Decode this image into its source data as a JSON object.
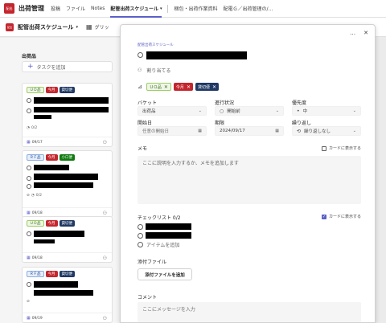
{
  "app": {
    "icon_text": "配出",
    "title": "出荷管理",
    "tabs": [
      {
        "label": "投稿"
      },
      {
        "label": "ファイル"
      },
      {
        "label": "Notes"
      },
      {
        "label": "配管出荷スケジュール"
      },
      {
        "label": "梱包・出荷作業資料"
      },
      {
        "label": "配電Ｇ／出荷管理の/..."
      }
    ]
  },
  "toolbar": {
    "plan_icon_text": "配出",
    "plan_name": "配管出荷スケジュール",
    "grid_label": "グリッ"
  },
  "board": {
    "bucket_title": "出荷品",
    "add_task": "タスクを追加",
    "cards": [
      {
        "labels": [
          "ＵＯ品",
          "今月",
          "貸切便"
        ],
        "checklist": "0/2",
        "date": "09/17"
      },
      {
        "labels": [
          "ＲＦ品",
          "今月",
          "小口便"
        ],
        "checklist": "0/2",
        "date": "09/18"
      },
      {
        "labels": [
          "ＵＯ品",
          "今月",
          "貸切便"
        ],
        "date": "09/18"
      },
      {
        "labels": [
          "ＲＦ品",
          "今月",
          "貸切便"
        ],
        "date": "09/19"
      }
    ]
  },
  "panel": {
    "breadcrumb": "配管出荷スケジュール",
    "more_icon": "…",
    "close_icon": "✕",
    "assign": "割り当てる",
    "labels": [
      "ＵＯ品",
      "今月",
      "貸切便"
    ],
    "bucket_label": "バケット",
    "bucket_value": "出荷品",
    "progress_label": "進行状況",
    "progress_value": "開始前",
    "priority_label": "優先度",
    "priority_value": "中",
    "start_label": "開始日",
    "start_placeholder": "任意の開始日",
    "due_label": "期限",
    "due_value": "2024/09/17",
    "repeat_label": "繰り返し",
    "repeat_value": "繰り返しなし",
    "notes_label": "メモ",
    "show_on_card": "カードに表示する",
    "notes_placeholder": "ここに説明を入力するか、メモを追加します",
    "checklist_label": "チェックリスト 0/2",
    "add_item": "アイテムを追加",
    "attachments_label": "添付ファイル",
    "attach_button": "添付ファイルを追加",
    "comments_label": "コメント",
    "comment_placeholder": "ここにメッセージを入力"
  }
}
